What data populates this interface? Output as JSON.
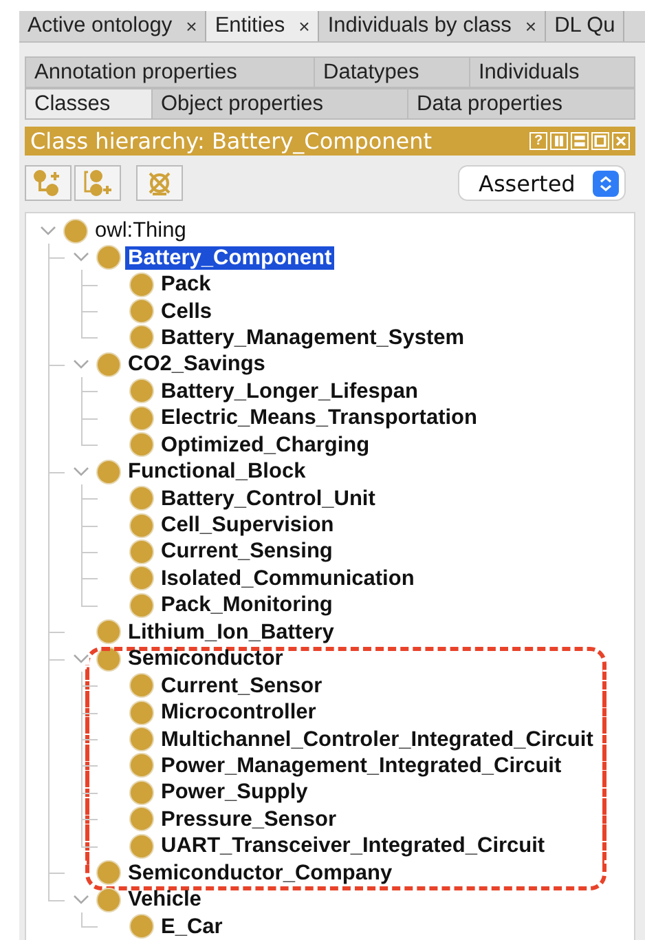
{
  "top_tabs": [
    {
      "label": "Active ontology",
      "close": "×",
      "selected": false
    },
    {
      "label": "Entities",
      "close": "×",
      "selected": true
    },
    {
      "label": "Individuals by class",
      "close": "×",
      "selected": false
    },
    {
      "label": "DL Qu",
      "selected": false
    }
  ],
  "entity_tabs": [
    [
      {
        "label": "Annotation properties",
        "selected": false
      },
      {
        "label": "Datatypes",
        "selected": false
      },
      {
        "label": "Individuals",
        "selected": false
      }
    ],
    [
      {
        "label": "Classes",
        "selected": true
      },
      {
        "label": "Object properties",
        "selected": false
      },
      {
        "label": "Data properties",
        "selected": false
      }
    ]
  ],
  "view": {
    "title": "Class hierarchy: Battery_Component",
    "help": "?"
  },
  "mode_select": {
    "value": "Asserted"
  },
  "tree": {
    "name": "owl:Thing",
    "expanded": true,
    "selected": false,
    "children": [
      {
        "name": "Battery_Component",
        "expanded": true,
        "selected": true,
        "children": [
          {
            "name": "Pack",
            "selected": false
          },
          {
            "name": "Cells",
            "selected": false
          },
          {
            "name": "Battery_Management_System",
            "selected": false
          }
        ]
      },
      {
        "name": "CO2_Savings",
        "expanded": true,
        "selected": false,
        "children": [
          {
            "name": "Battery_Longer_Lifespan",
            "selected": false
          },
          {
            "name": "Electric_Means_Transportation",
            "selected": false
          },
          {
            "name": "Optimized_Charging",
            "selected": false
          }
        ]
      },
      {
        "name": "Functional_Block",
        "expanded": true,
        "selected": false,
        "children": [
          {
            "name": "Battery_Control_Unit",
            "selected": false
          },
          {
            "name": "Cell_Supervision",
            "selected": false
          },
          {
            "name": "Current_Sensing",
            "selected": false
          },
          {
            "name": "Isolated_Communication",
            "selected": false
          },
          {
            "name": "Pack_Monitoring",
            "selected": false
          }
        ]
      },
      {
        "name": "Lithium_Ion_Battery",
        "selected": false
      },
      {
        "name": "Semiconductor",
        "expanded": true,
        "selected": false,
        "highlighted": true,
        "children": [
          {
            "name": "Current_Sensor",
            "selected": false,
            "highlighted": true
          },
          {
            "name": "Microcontroller",
            "selected": false,
            "highlighted": true
          },
          {
            "name": "Multichannel_Controler_Integrated_Circuit",
            "selected": false,
            "highlighted": true
          },
          {
            "name": "Power_Management_Integrated_Circuit",
            "selected": false,
            "highlighted": true
          },
          {
            "name": "Power_Supply",
            "selected": false,
            "highlighted": true
          },
          {
            "name": "Pressure_Sensor",
            "selected": false,
            "highlighted": true
          },
          {
            "name": "UART_Transceiver_Integrated_Circuit",
            "selected": false,
            "highlighted": true
          }
        ]
      },
      {
        "name": "Semiconductor_Company",
        "selected": false,
        "highlighted": true
      },
      {
        "name": "Vehicle",
        "expanded": true,
        "selected": false,
        "children": [
          {
            "name": "E_Car",
            "selected": false
          }
        ]
      }
    ]
  }
}
